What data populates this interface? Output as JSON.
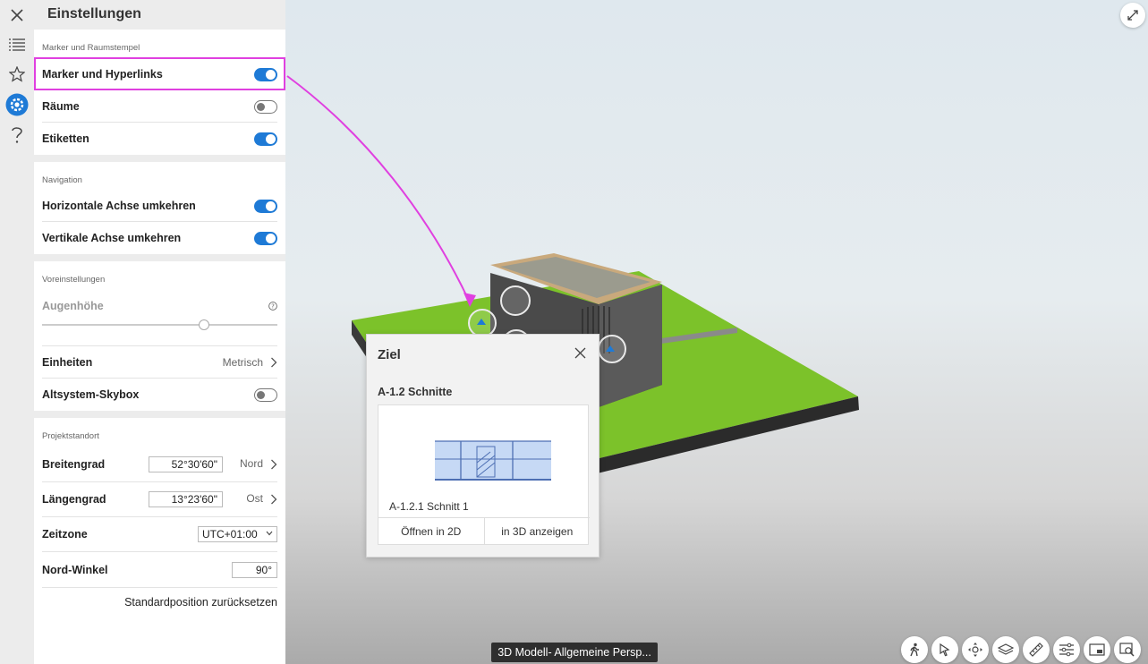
{
  "panel": {
    "title": "Einstellungen",
    "sections": {
      "markers": {
        "label": "Marker und Raumstempel",
        "rows": [
          {
            "label": "Marker und Hyperlinks",
            "on": true
          },
          {
            "label": "Räume",
            "on": false
          },
          {
            "label": "Etiketten",
            "on": true
          }
        ]
      },
      "navigation": {
        "label": "Navigation",
        "rows": [
          {
            "label": "Horizontale Achse umkehren",
            "on": true
          },
          {
            "label": "Vertikale Achse umkehren",
            "on": true
          }
        ]
      },
      "presets": {
        "label": "Voreinstellungen",
        "eye_height_label": "Augenhöhe",
        "eye_height_fraction": 0.69,
        "units_label": "Einheiten",
        "units_value": "Metrisch",
        "skybox_label": "Altsystem-Skybox",
        "skybox_on": false
      },
      "location": {
        "label": "Projektstandort",
        "latitude_label": "Breitengrad",
        "latitude_value": "52°30'60\"",
        "latitude_dir": "Nord",
        "longitude_label": "Längengrad",
        "longitude_value": "13°23'60\"",
        "longitude_dir": "Ost",
        "timezone_label": "Zeitzone",
        "timezone_value": "UTC+01:00",
        "north_label": "Nord-Winkel",
        "north_value": "90°",
        "reset_label": "Standardposition zurücksetzen"
      }
    }
  },
  "popup": {
    "title": "Ziel",
    "subtitle": "A-1.2 Schnitte",
    "caption": "A-1.2.1 Schnitt 1",
    "open_2d": "Öffnen in 2D",
    "show_3d": "in 3D anzeigen"
  },
  "view_label": "3D Modell- Allgemeine Persp...",
  "colors": {
    "accent": "#1e7ad6",
    "highlight": "#e040e0",
    "grass": "#7cc22a"
  },
  "icons": {
    "rail": [
      "close-icon",
      "list-icon",
      "star-icon",
      "gear-icon",
      "help-icon"
    ],
    "toolbar": [
      "walk-icon",
      "select-icon",
      "orbit-icon",
      "layers-icon",
      "measure-icon",
      "settings-sliders-icon",
      "minimap-icon",
      "zoom-search-icon"
    ]
  }
}
